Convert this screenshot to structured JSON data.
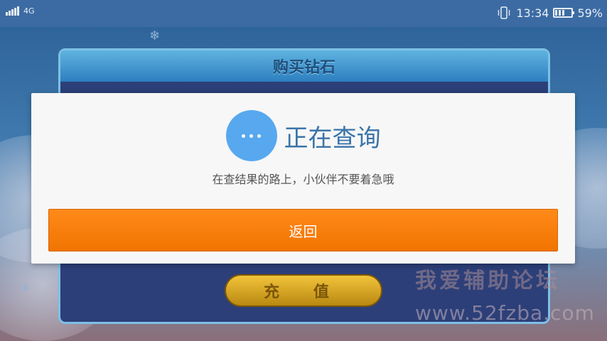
{
  "status_bar": {
    "network_type": "4G",
    "time": "13:34",
    "battery_percent": "59%",
    "battery_level": 0.59,
    "icons": [
      "signal-icon",
      "vibrate-icon",
      "battery-icon"
    ]
  },
  "game": {
    "panel_title": "购买钻石",
    "recharge_label": "充 值"
  },
  "dialog": {
    "title": "正在查询",
    "message": "在查结果的路上，小伙伴不要着急哦",
    "back_label": "返回",
    "icon": "loading-dots-icon",
    "colors": {
      "accent": "#57a8ef",
      "button": "#f57e0d",
      "title": "#3b74a8"
    }
  },
  "watermark": {
    "line1": "我爱辅助论坛",
    "line2": "www.52fzba.com"
  }
}
